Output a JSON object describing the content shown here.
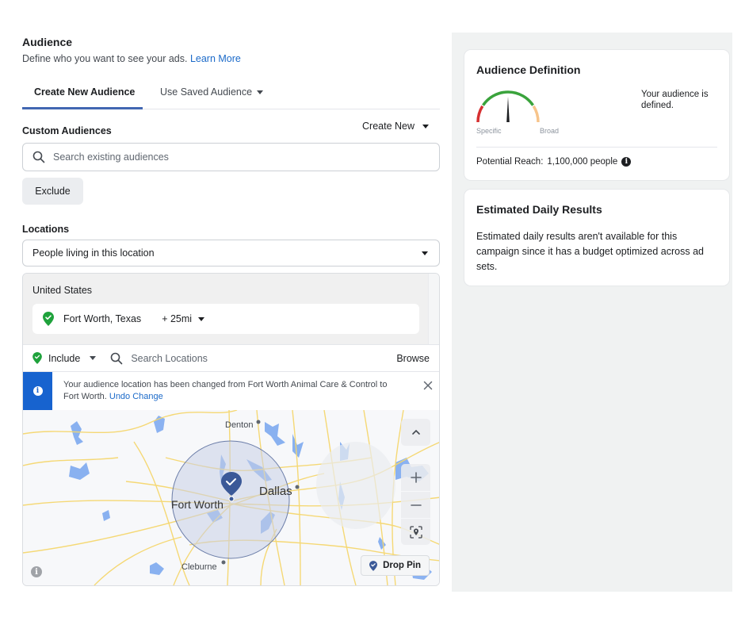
{
  "audience": {
    "title": "Audience",
    "subtitle": "Define who you want to see your ads.",
    "learn_more": "Learn More"
  },
  "tabs": [
    {
      "label": "Create New Audience",
      "active": true
    },
    {
      "label": "Use Saved Audience",
      "active": false
    }
  ],
  "custom_audiences": {
    "label": "Custom Audiences",
    "create_new": "Create New",
    "search_placeholder": "Search existing audiences",
    "exclude_button": "Exclude"
  },
  "locations": {
    "label": "Locations",
    "selected_type": "People living in this location",
    "country": "United States",
    "location_item": {
      "name": "Fort Worth, Texas",
      "radius": "+ 25mi"
    },
    "include_label": "Include",
    "search_placeholder": "Search Locations",
    "browse_label": "Browse",
    "notice": {
      "text": "Your audience location has been changed from Fort Worth Animal Care & Control to Fort Worth.",
      "undo_label": "Undo Change"
    }
  },
  "map": {
    "cities": [
      {
        "name": "Denton",
        "major": false
      },
      {
        "name": "Dallas",
        "major": true
      },
      {
        "name": "Fort Worth",
        "major": true
      },
      {
        "name": "Cleburne",
        "major": false
      }
    ],
    "drop_pin_label": "Drop Pin",
    "colors": {
      "road": "#f5d76e",
      "water": "#6ea0f0",
      "radius_fill": "#c9d0e6",
      "pin": "#3b5998"
    }
  },
  "audience_definition": {
    "title": "Audience Definition",
    "status_text": "Your audience is defined.",
    "gauge_min_label": "Specific",
    "gauge_max_label": "Broad",
    "gauge_value": 0.5,
    "potential_reach_label": "Potential Reach:",
    "potential_reach_value": "1,100,000 people",
    "colors": {
      "specific": "#d63031",
      "defined": "#3aa33c",
      "broad": "#f7c48b"
    }
  },
  "estimated_daily_results": {
    "title": "Estimated Daily Results",
    "text": "Estimated daily results aren't available for this campaign since it has a budget optimized across ad sets."
  }
}
